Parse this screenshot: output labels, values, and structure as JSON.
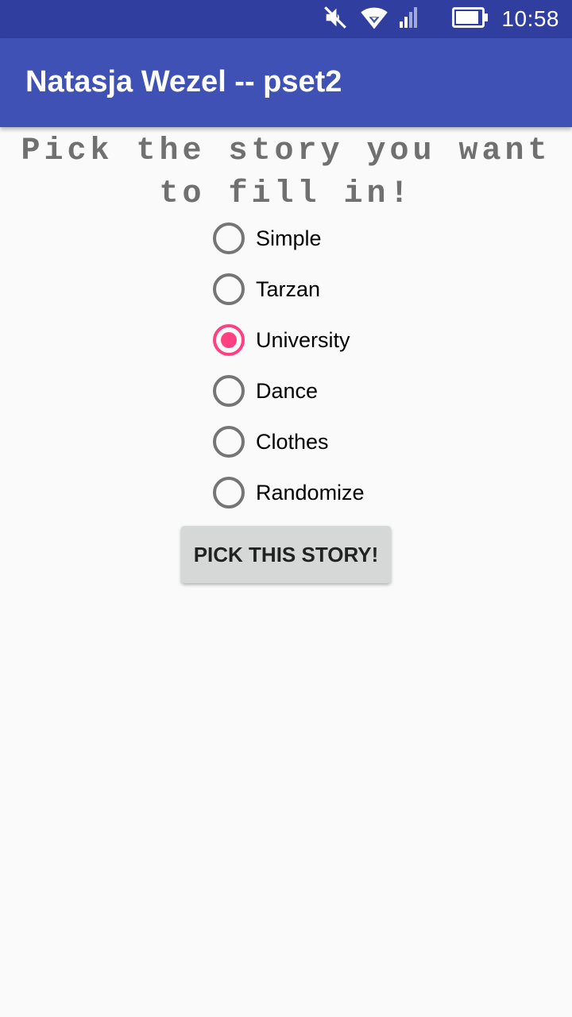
{
  "status_bar": {
    "time": "10:58",
    "icons": [
      "mute-vibrate-icon",
      "wifi-icon",
      "signal-icon",
      "battery-icon"
    ],
    "background_color": "#303f9f"
  },
  "app_bar": {
    "title": "Natasja Wezel -- pset2",
    "background_color": "#3f51b5"
  },
  "main": {
    "heading": "Pick the story you want to fill in!",
    "options": [
      {
        "label": "Simple",
        "checked": false
      },
      {
        "label": "Tarzan",
        "checked": false
      },
      {
        "label": "University",
        "checked": true
      },
      {
        "label": "Dance",
        "checked": false
      },
      {
        "label": "Clothes",
        "checked": false
      },
      {
        "label": "Randomize",
        "checked": false
      }
    ],
    "selected_option": "University",
    "button_label": "PICK THIS STORY!"
  },
  "colors": {
    "accent": "#ff4081",
    "unchecked_radio": "#757575",
    "background": "#fafafa"
  }
}
